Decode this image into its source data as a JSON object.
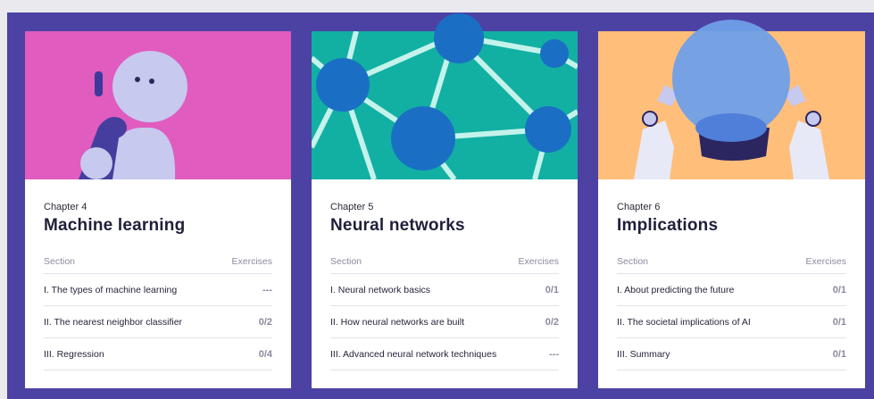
{
  "cards": [
    {
      "chapter": "Chapter 4",
      "title": "Machine learning",
      "section_header": "Section",
      "exercises_header": "Exercises",
      "rows": [
        {
          "label": "I. The types of machine learning",
          "score": "---"
        },
        {
          "label": "II. The nearest neighbor classifier",
          "score": "0/2"
        },
        {
          "label": "III. Regression",
          "score": "0/4"
        }
      ],
      "hero_color": "#e05cbf"
    },
    {
      "chapter": "Chapter 5",
      "title": "Neural networks",
      "section_header": "Section",
      "exercises_header": "Exercises",
      "rows": [
        {
          "label": "I. Neural network basics",
          "score": "0/1"
        },
        {
          "label": "II. How neural networks are built",
          "score": "0/2"
        },
        {
          "label": "III. Advanced neural network techniques",
          "score": "---"
        }
      ],
      "hero_color": "#12b0a3"
    },
    {
      "chapter": "Chapter 6",
      "title": "Implications",
      "section_header": "Section",
      "exercises_header": "Exercises",
      "rows": [
        {
          "label": "I. About predicting the future",
          "score": "0/1"
        },
        {
          "label": "II. The societal implications of AI",
          "score": "0/1"
        },
        {
          "label": "III. Summary",
          "score": "0/1"
        }
      ],
      "hero_color": "#ffbe7a"
    }
  ]
}
